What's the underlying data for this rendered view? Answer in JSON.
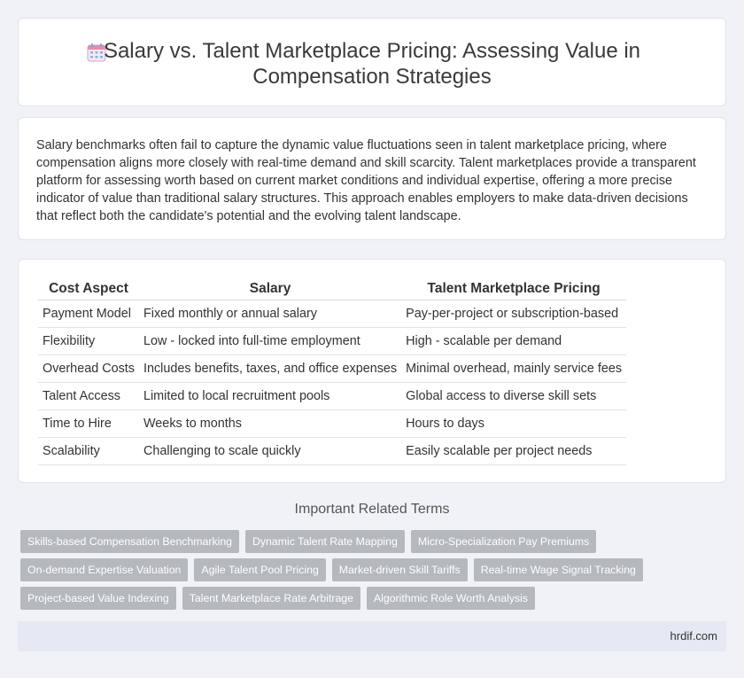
{
  "header": {
    "title": "Salary vs. Talent Marketplace Pricing: Assessing Value in Compensation Strategies",
    "icon": "calendar-icon"
  },
  "intro": {
    "text": "Salary benchmarks often fail to capture the dynamic value fluctuations seen in talent marketplace pricing, where compensation aligns more closely with real-time demand and skill scarcity. Talent marketplaces provide a transparent platform for assessing worth based on current market conditions and individual expertise, offering a more precise indicator of value than traditional salary structures. This approach enables employers to make data-driven decisions that reflect both the candidate's potential and the evolving talent landscape."
  },
  "table": {
    "headers": [
      "Cost Aspect",
      "Salary",
      "Talent Marketplace Pricing"
    ],
    "rows": [
      [
        "Payment Model",
        "Fixed monthly or annual salary",
        "Pay-per-project or subscription-based"
      ],
      [
        "Flexibility",
        "Low - locked into full-time employment",
        "High - scalable per demand"
      ],
      [
        "Overhead Costs",
        "Includes benefits, taxes, and office expenses",
        "Minimal overhead, mainly service fees"
      ],
      [
        "Talent Access",
        "Limited to local recruitment pools",
        "Global access to diverse skill sets"
      ],
      [
        "Time to Hire",
        "Weeks to months",
        "Hours to days"
      ],
      [
        "Scalability",
        "Challenging to scale quickly",
        "Easily scalable per project needs"
      ]
    ]
  },
  "related": {
    "heading": "Important Related Terms",
    "rows": [
      [
        "Skills-based Compensation Benchmarking",
        "Dynamic Talent Rate Mapping",
        "Micro-Specialization Pay Premiums"
      ],
      [
        "On-demand Expertise Valuation",
        "Agile Talent Pool Pricing",
        "Market-driven Skill Tariffs",
        "Real-time Wage Signal Tracking"
      ],
      [
        "Project-based Value Indexing",
        "Talent Marketplace Rate Arbitrage",
        "Algorithmic Role Worth Analysis"
      ]
    ]
  },
  "footer": {
    "site": "hrdif.com"
  },
  "colors": {
    "background": "#f0f2f7",
    "tag": "#b5b8bf",
    "footer": "#e6e9f3"
  }
}
